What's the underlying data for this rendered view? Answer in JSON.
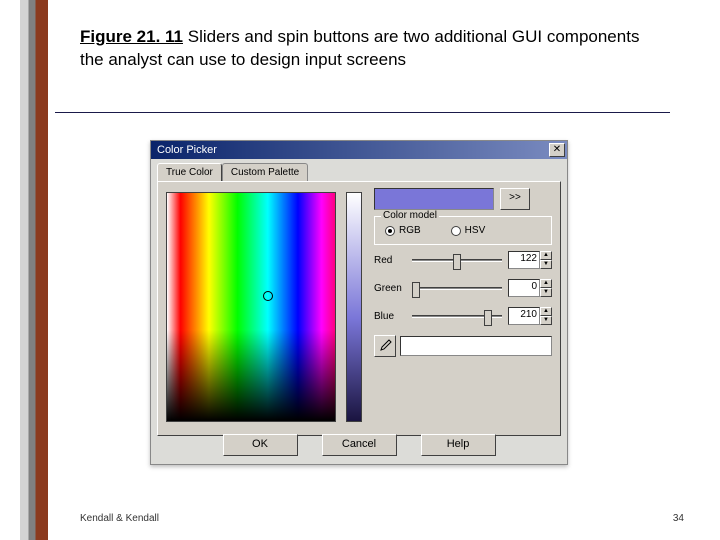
{
  "figure": {
    "label": "Figure 21. 11",
    "caption": "Sliders and spin buttons are two additional GUI components the analyst can use to design input screens"
  },
  "footer": {
    "credit": "Kendall & Kendall",
    "page": "34"
  },
  "picker": {
    "title": "Color Picker",
    "tabs": {
      "true_color": "True Color",
      "custom": "Custom Palette"
    },
    "add_swatch_label": ">>",
    "color_model": {
      "legend": "Color model",
      "rgb": "RGB",
      "hsv": "HSV"
    },
    "channels": {
      "red": {
        "label": "Red",
        "value": "122"
      },
      "green": {
        "label": "Green",
        "value": "0"
      },
      "blue": {
        "label": "Blue",
        "value": "210"
      }
    },
    "buttons": {
      "ok": "OK",
      "cancel": "Cancel",
      "help": "Help"
    }
  }
}
